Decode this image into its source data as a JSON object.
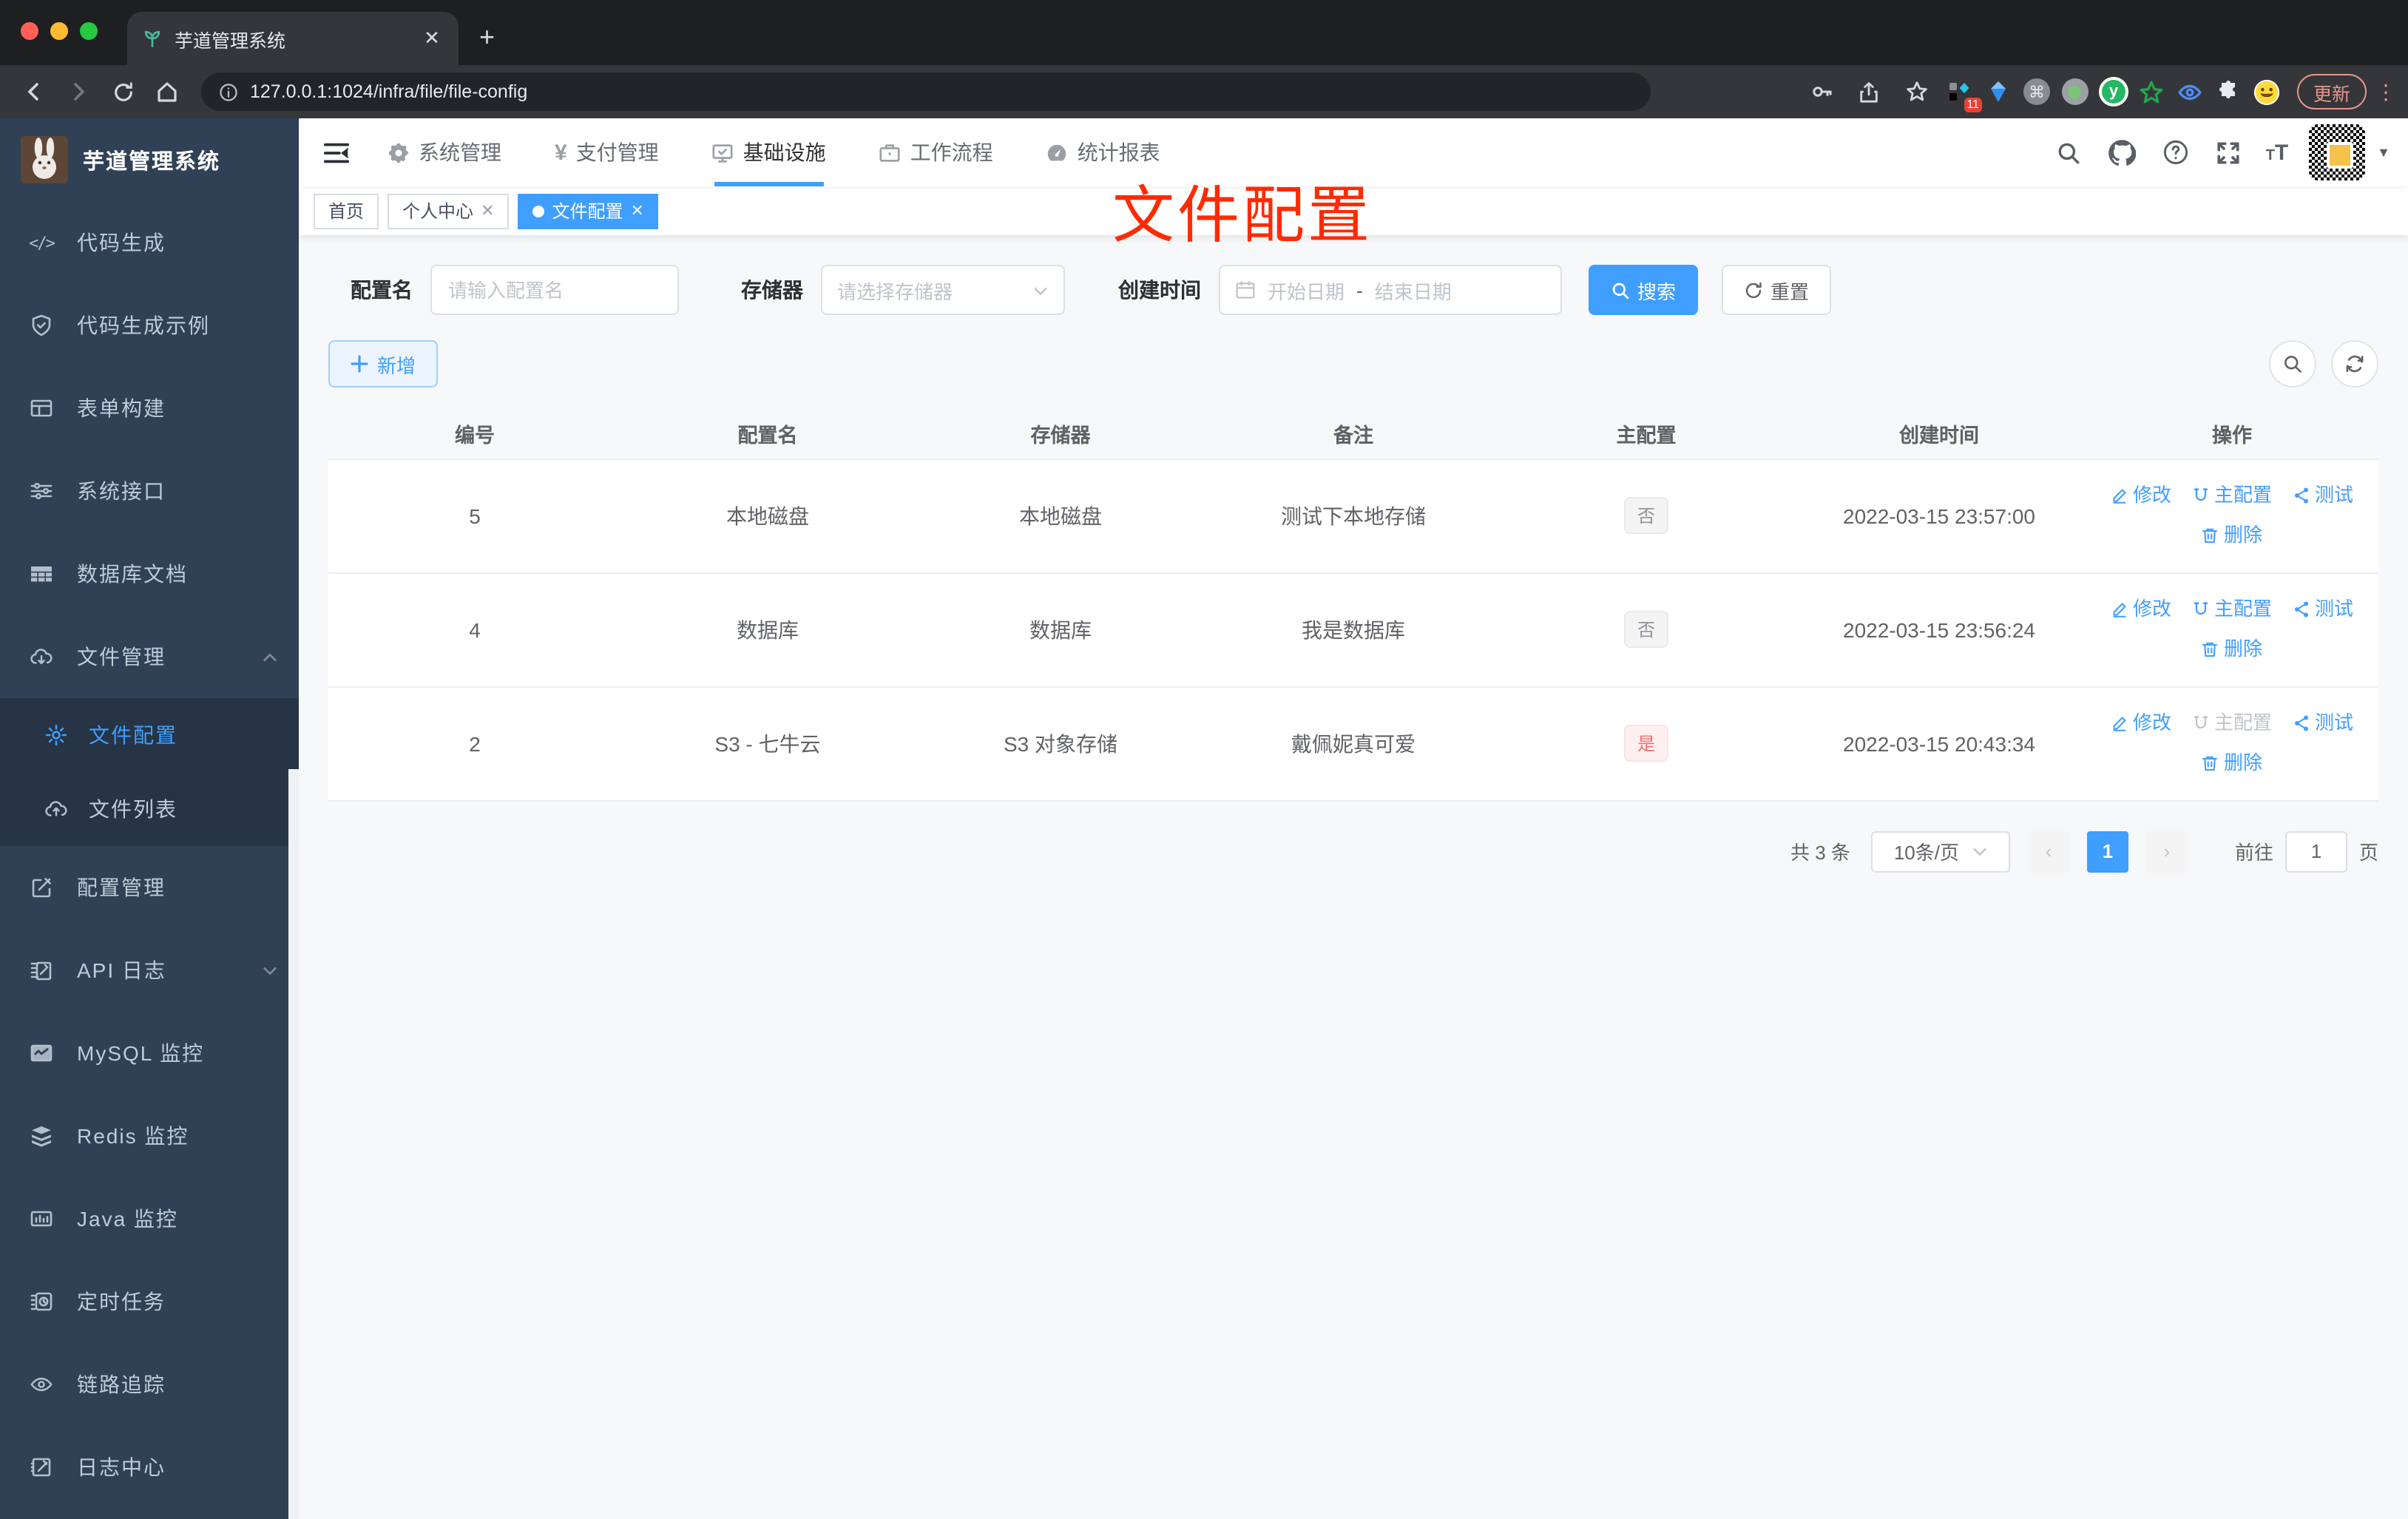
{
  "browser": {
    "tab_title": "芋道管理系统",
    "url": "127.0.0.1:1024/infra/file/file-config",
    "update_button": "更新",
    "extension_badge": "11"
  },
  "sidebar": {
    "logo_title": "芋道管理系统",
    "items": [
      {
        "label": "代码生成"
      },
      {
        "label": "代码生成示例"
      },
      {
        "label": "表单构建"
      },
      {
        "label": "系统接口"
      },
      {
        "label": "数据库文档"
      },
      {
        "label": "文件管理"
      },
      {
        "label": "文件配置"
      },
      {
        "label": "文件列表"
      },
      {
        "label": "配置管理"
      },
      {
        "label": "API 日志"
      },
      {
        "label": "MySQL 监控"
      },
      {
        "label": "Redis 监控"
      },
      {
        "label": "Java 监控"
      },
      {
        "label": "定时任务"
      },
      {
        "label": "链路追踪"
      },
      {
        "label": "日志中心"
      }
    ]
  },
  "topnav": {
    "items": [
      {
        "label": "系统管理"
      },
      {
        "label": "支付管理"
      },
      {
        "label": "基础设施",
        "active": true
      },
      {
        "label": "工作流程"
      },
      {
        "label": "统计报表"
      }
    ]
  },
  "tags": {
    "items": [
      {
        "label": "首页"
      },
      {
        "label": "个人中心",
        "closable": true
      },
      {
        "label": "文件配置",
        "active": true,
        "closable": true
      }
    ]
  },
  "annotation": {
    "text": "文件配置",
    "color": "#ff2b00"
  },
  "filters": {
    "name_label": "配置名",
    "name_placeholder": "请输入配置名",
    "storage_label": "存储器",
    "storage_placeholder": "请选择存储器",
    "date_label": "创建时间",
    "date_start_placeholder": "开始日期",
    "date_separator": "-",
    "date_end_placeholder": "结束日期",
    "search_button": "搜索",
    "reset_button": "重置"
  },
  "toolbar": {
    "add_button": "新增"
  },
  "table": {
    "columns": [
      "编号",
      "配置名",
      "存储器",
      "备注",
      "主配置",
      "创建时间",
      "操作"
    ],
    "rows": [
      {
        "id": "5",
        "name": "本地磁盘",
        "storage": "本地磁盘",
        "remark": "测试下本地存储",
        "master": "否",
        "master_type": "info",
        "created": "2022-03-15 23:57:00",
        "actions": {
          "edit": "修改",
          "master": "主配置",
          "master_disabled": false,
          "test": "测试",
          "delete": "删除"
        }
      },
      {
        "id": "4",
        "name": "数据库",
        "storage": "数据库",
        "remark": "我是数据库",
        "master": "否",
        "master_type": "info",
        "created": "2022-03-15 23:56:24",
        "actions": {
          "edit": "修改",
          "master": "主配置",
          "master_disabled": false,
          "test": "测试",
          "delete": "删除"
        }
      },
      {
        "id": "2",
        "name": "S3 - 七牛云",
        "storage": "S3 对象存储",
        "remark": "戴佩妮真可爱",
        "master": "是",
        "master_type": "danger",
        "created": "2022-03-15 20:43:34",
        "actions": {
          "edit": "修改",
          "master": "主配置",
          "master_disabled": true,
          "test": "测试",
          "delete": "删除"
        }
      }
    ]
  },
  "pagination": {
    "total": "共 3 条",
    "page_size": "10条/页",
    "current_page": "1",
    "goto_label": "前往",
    "goto_value": "1",
    "page_suffix": "页"
  },
  "colors": {
    "accent": "#409eff",
    "danger": "#f56c6c",
    "sidebar_bg": "#304156"
  }
}
